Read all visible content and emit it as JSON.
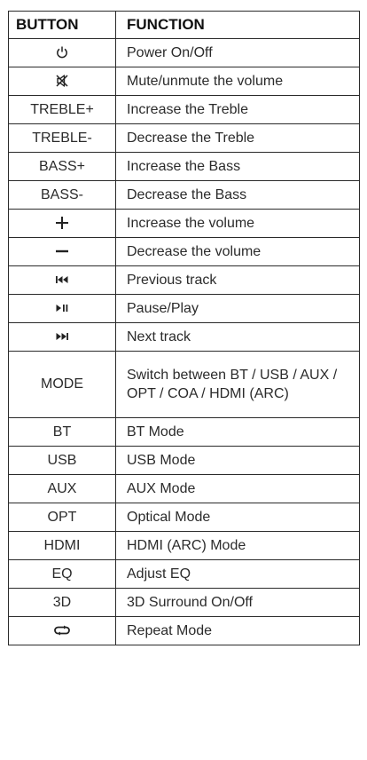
{
  "header": {
    "button": "BUTTON",
    "function": "FUNCTION"
  },
  "rows": [
    {
      "button": "",
      "icon": "power-icon",
      "function": "Power On/Off"
    },
    {
      "button": "",
      "icon": "mute-icon",
      "function": "Mute/unmute the volume"
    },
    {
      "button": "TREBLE+",
      "function": "Increase the Treble"
    },
    {
      "button": "TREBLE-",
      "function": "Decrease the Treble"
    },
    {
      "button": "BASS+",
      "function": "Increase the Bass"
    },
    {
      "button": "BASS-",
      "function": "Decrease the Bass"
    },
    {
      "button": "",
      "icon": "plus-icon",
      "function": "Increase the volume"
    },
    {
      "button": "",
      "icon": "minus-icon",
      "function": "Decrease the volume"
    },
    {
      "button": "",
      "icon": "previous-track-icon",
      "function": "Previous track"
    },
    {
      "button": "",
      "icon": "play-pause-icon",
      "function": "Pause/Play"
    },
    {
      "button": "",
      "icon": "next-track-icon",
      "function": "Next track"
    },
    {
      "button": "MODE",
      "function": "Switch between BT / USB / AUX / OPT / COA / HDMI (ARC)"
    },
    {
      "button": "BT",
      "function": "BT Mode"
    },
    {
      "button": "USB",
      "function": "USB Mode"
    },
    {
      "button": "AUX",
      "function": "AUX Mode"
    },
    {
      "button": "OPT",
      "function": "Optical Mode"
    },
    {
      "button": "HDMI",
      "function": "HDMI (ARC) Mode"
    },
    {
      "button": "EQ",
      "function": "Adjust EQ"
    },
    {
      "button": "3D",
      "function": "3D Surround On/Off"
    },
    {
      "button": "",
      "icon": "repeat-icon",
      "function": "Repeat Mode"
    }
  ]
}
